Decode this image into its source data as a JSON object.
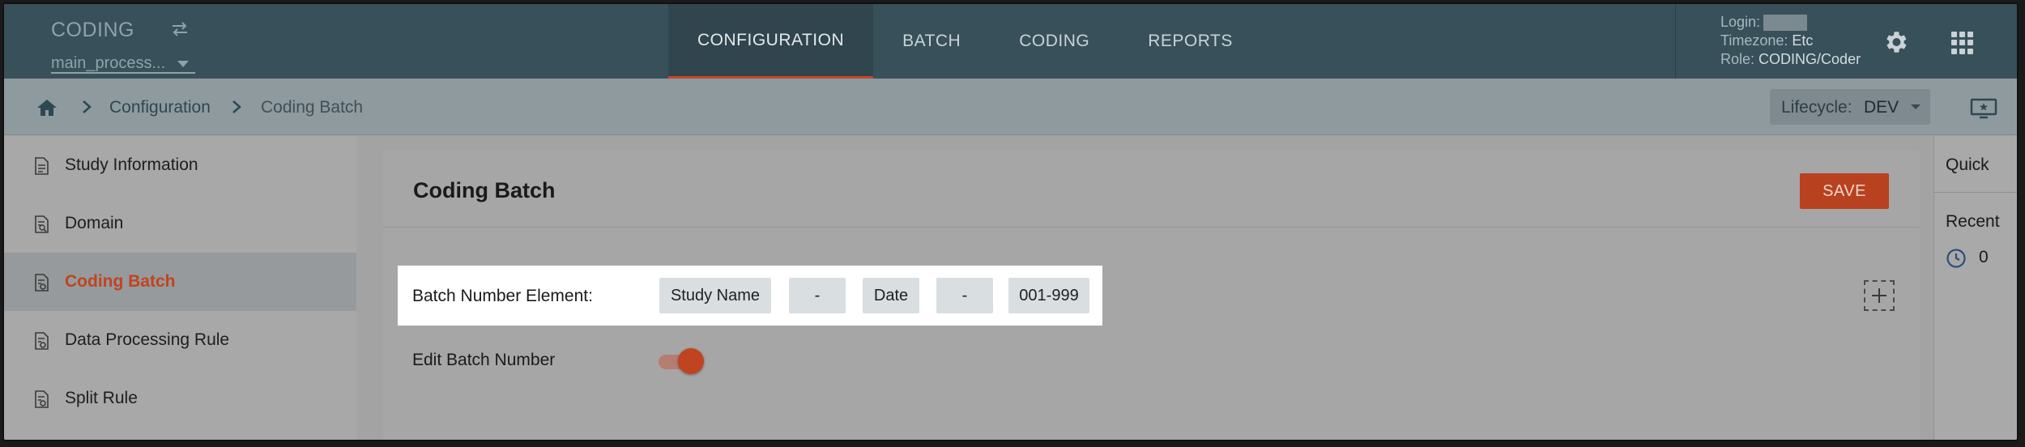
{
  "header": {
    "app_title": "CODING",
    "process": "main_process...",
    "nav": [
      "CONFIGURATION",
      "BATCH",
      "CODING",
      "REPORTS"
    ],
    "active_nav": "CONFIGURATION",
    "user": {
      "login_label": "Login:",
      "timezone_label": "Timezone:",
      "timezone_value": "Etc",
      "role_label": "Role:",
      "role_value": "CODING/Coder"
    }
  },
  "breadcrumb": {
    "items": [
      "Configuration",
      "Coding Batch"
    ],
    "lifecycle_label": "Lifecycle:",
    "lifecycle_value": "DEV"
  },
  "sidebar": {
    "items": [
      {
        "label": "Study Information",
        "icon": "document-icon"
      },
      {
        "label": "Domain",
        "icon": "document-search-icon"
      },
      {
        "label": "Coding Batch",
        "icon": "document-settings-icon",
        "active": true
      },
      {
        "label": "Data Processing Rule",
        "icon": "document-settings-icon"
      },
      {
        "label": "Split Rule",
        "icon": "document-settings-icon"
      }
    ]
  },
  "main": {
    "title": "Coding Batch",
    "save_label": "SAVE",
    "batch_number_label": "Batch Number Element:",
    "batch_elements": [
      "Study Name",
      "-",
      "Date",
      "-",
      "001-999"
    ],
    "edit_batch_label": "Edit Batch Number",
    "edit_batch_enabled": true
  },
  "right_panel": {
    "quick_label": "Quick",
    "recent_label": "Recent",
    "recent_count": "0"
  },
  "colors": {
    "header_bg": "#38505a",
    "accent": "#c0441f"
  }
}
